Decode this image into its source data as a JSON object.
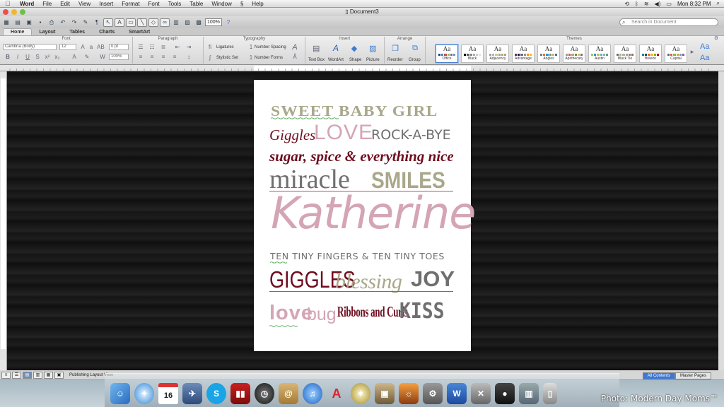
{
  "menubar": {
    "apple_icon": "apple-icon",
    "app_name": "Word",
    "items": [
      "File",
      "Edit",
      "View",
      "Insert",
      "Format",
      "Font",
      "Tools",
      "Table",
      "Window",
      "Help"
    ],
    "clock": "Mon 8:32 PM"
  },
  "window": {
    "title": "Document3"
  },
  "toolbar": {
    "zoom": "100%",
    "search_placeholder": "Search in Document"
  },
  "ribbon": {
    "tabs": [
      "Home",
      "Layout",
      "Tables",
      "Charts",
      "SmartArt"
    ],
    "active_tab": "Home",
    "groups": {
      "font": "Font",
      "paragraph": "Paragraph",
      "typography": "Typography",
      "insert": "Insert",
      "arrange": "Arrange",
      "themes": "Themes"
    },
    "font_name": "Cambria (Body)",
    "font_size": "12",
    "spacing_value": "0 pt",
    "zoom_field": "100%",
    "ligatures": "Ligatures",
    "number_spacing": "Number Spacing",
    "stylistic_set": "Stylistic Set",
    "number_forms": "Number Forms",
    "insert_items": [
      "Text Box",
      "WordArt",
      "Shape",
      "Picture"
    ],
    "arrange_items": [
      "Reorder",
      "Group"
    ],
    "themes": [
      {
        "name": "Office",
        "colors": [
          "#1f497d",
          "#4f81bd",
          "#c0504d",
          "#9bbb59",
          "#8064a2",
          "#4bacc6"
        ]
      },
      {
        "name": "Black",
        "colors": [
          "#000000",
          "#555555",
          "#888888",
          "#aaaaaa",
          "#cccccc",
          "#e0e0e0"
        ]
      },
      {
        "name": "Adjacency",
        "colors": [
          "#a9a57c",
          "#9cbebd",
          "#d2cb6c",
          "#95a39d",
          "#c89f5d",
          "#b1a089"
        ]
      },
      {
        "name": "Advantage",
        "colors": [
          "#663366",
          "#330f42",
          "#666699",
          "#999966",
          "#f7901e",
          "#feb80a"
        ]
      },
      {
        "name": "Angles",
        "colors": [
          "#797b7e",
          "#f96a1b",
          "#08a1d9",
          "#7c984a",
          "#c2ad8d",
          "#506e94"
        ]
      },
      {
        "name": "Apothecary",
        "colors": [
          "#93a299",
          "#cf543f",
          "#b5ae53",
          "#848058",
          "#e8b54d",
          "#786c71"
        ]
      },
      {
        "name": "Austin",
        "colors": [
          "#94c954",
          "#3494ba",
          "#d8b25c",
          "#58b6c0",
          "#75bda7",
          "#7a8c8e"
        ]
      },
      {
        "name": "Black Tie",
        "colors": [
          "#6f6f74",
          "#a7b789",
          "#beae98",
          "#92a9b9",
          "#9c8265",
          "#8d6974"
        ]
      },
      {
        "name": "Breeze",
        "colors": [
          "#2c7c9f",
          "#244a58",
          "#e2751d",
          "#ffb400",
          "#7eb606",
          "#c00000"
        ]
      },
      {
        "name": "Capital",
        "colors": [
          "#4e6f8f",
          "#d66b2e",
          "#8bb446",
          "#dca130",
          "#65a0c1",
          "#8f5a8a"
        ]
      }
    ]
  },
  "document": {
    "line1": "SWEET BABY GIRL",
    "line2a": "Giggles",
    "line2b": "LOVE",
    "line2c": "ROCK-A-BYE",
    "line3": "sugar, spice & everything nice",
    "line4a": "miracle",
    "line4b": "SMILES",
    "line5": "Katherine",
    "line6": "TEN TINY FINGERS & TEN TINY TOES",
    "line7a": "GIGGLES",
    "line7b": "blessing",
    "line7c": "JOY",
    "line8a": "love",
    "line8b": "bug",
    "line8c": "Ribbons and Curls",
    "line8d": "KISS"
  },
  "colors": {
    "khaki": "#a9a88b",
    "pink": "#d4a5b4",
    "maroon": "#6e0d1e",
    "gray": "#6f6f6f"
  },
  "statusbar": {
    "view_label": "Publishing Layout View",
    "tab_all": "All Contents",
    "tab_master": "Master Pages"
  },
  "dock": {
    "icons": [
      "finder-icon",
      "safari-icon",
      "calendar-icon",
      "preview-icon",
      "skype-icon",
      "photo-booth-icon",
      "dashboard-icon",
      "address-book-icon",
      "itunes-icon",
      "font-book-icon",
      "iphoto-icon",
      "image-capture-icon",
      "system-preferences-icon",
      "word-icon",
      "activity-monitor-icon",
      "growl-icon",
      "photos-icon",
      "documents-icon",
      "trash-icon"
    ],
    "calendar_day": "16"
  },
  "credit": "Photo: Modern Day Moms™"
}
